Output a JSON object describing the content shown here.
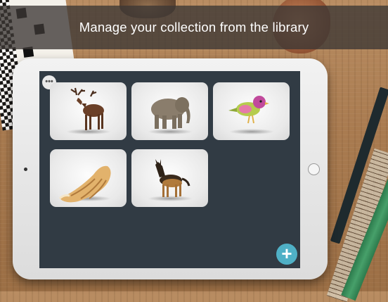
{
  "banner": {
    "title": "Manage your collection from the library"
  },
  "library": {
    "items": [
      {
        "name": "Deer",
        "icon": "deer-model"
      },
      {
        "name": "Elephant",
        "icon": "elephant-model"
      },
      {
        "name": "Bird",
        "icon": "bird-model"
      },
      {
        "name": "Seashell",
        "icon": "seashell-model"
      },
      {
        "name": "German Shepherd",
        "icon": "dog-model"
      }
    ]
  },
  "controls": {
    "more_glyph": "•••",
    "add_glyph": "+"
  },
  "colors": {
    "screen_bg": "#313b44",
    "accent": "#4fb0c6",
    "banner_bg": "#3c3734"
  }
}
